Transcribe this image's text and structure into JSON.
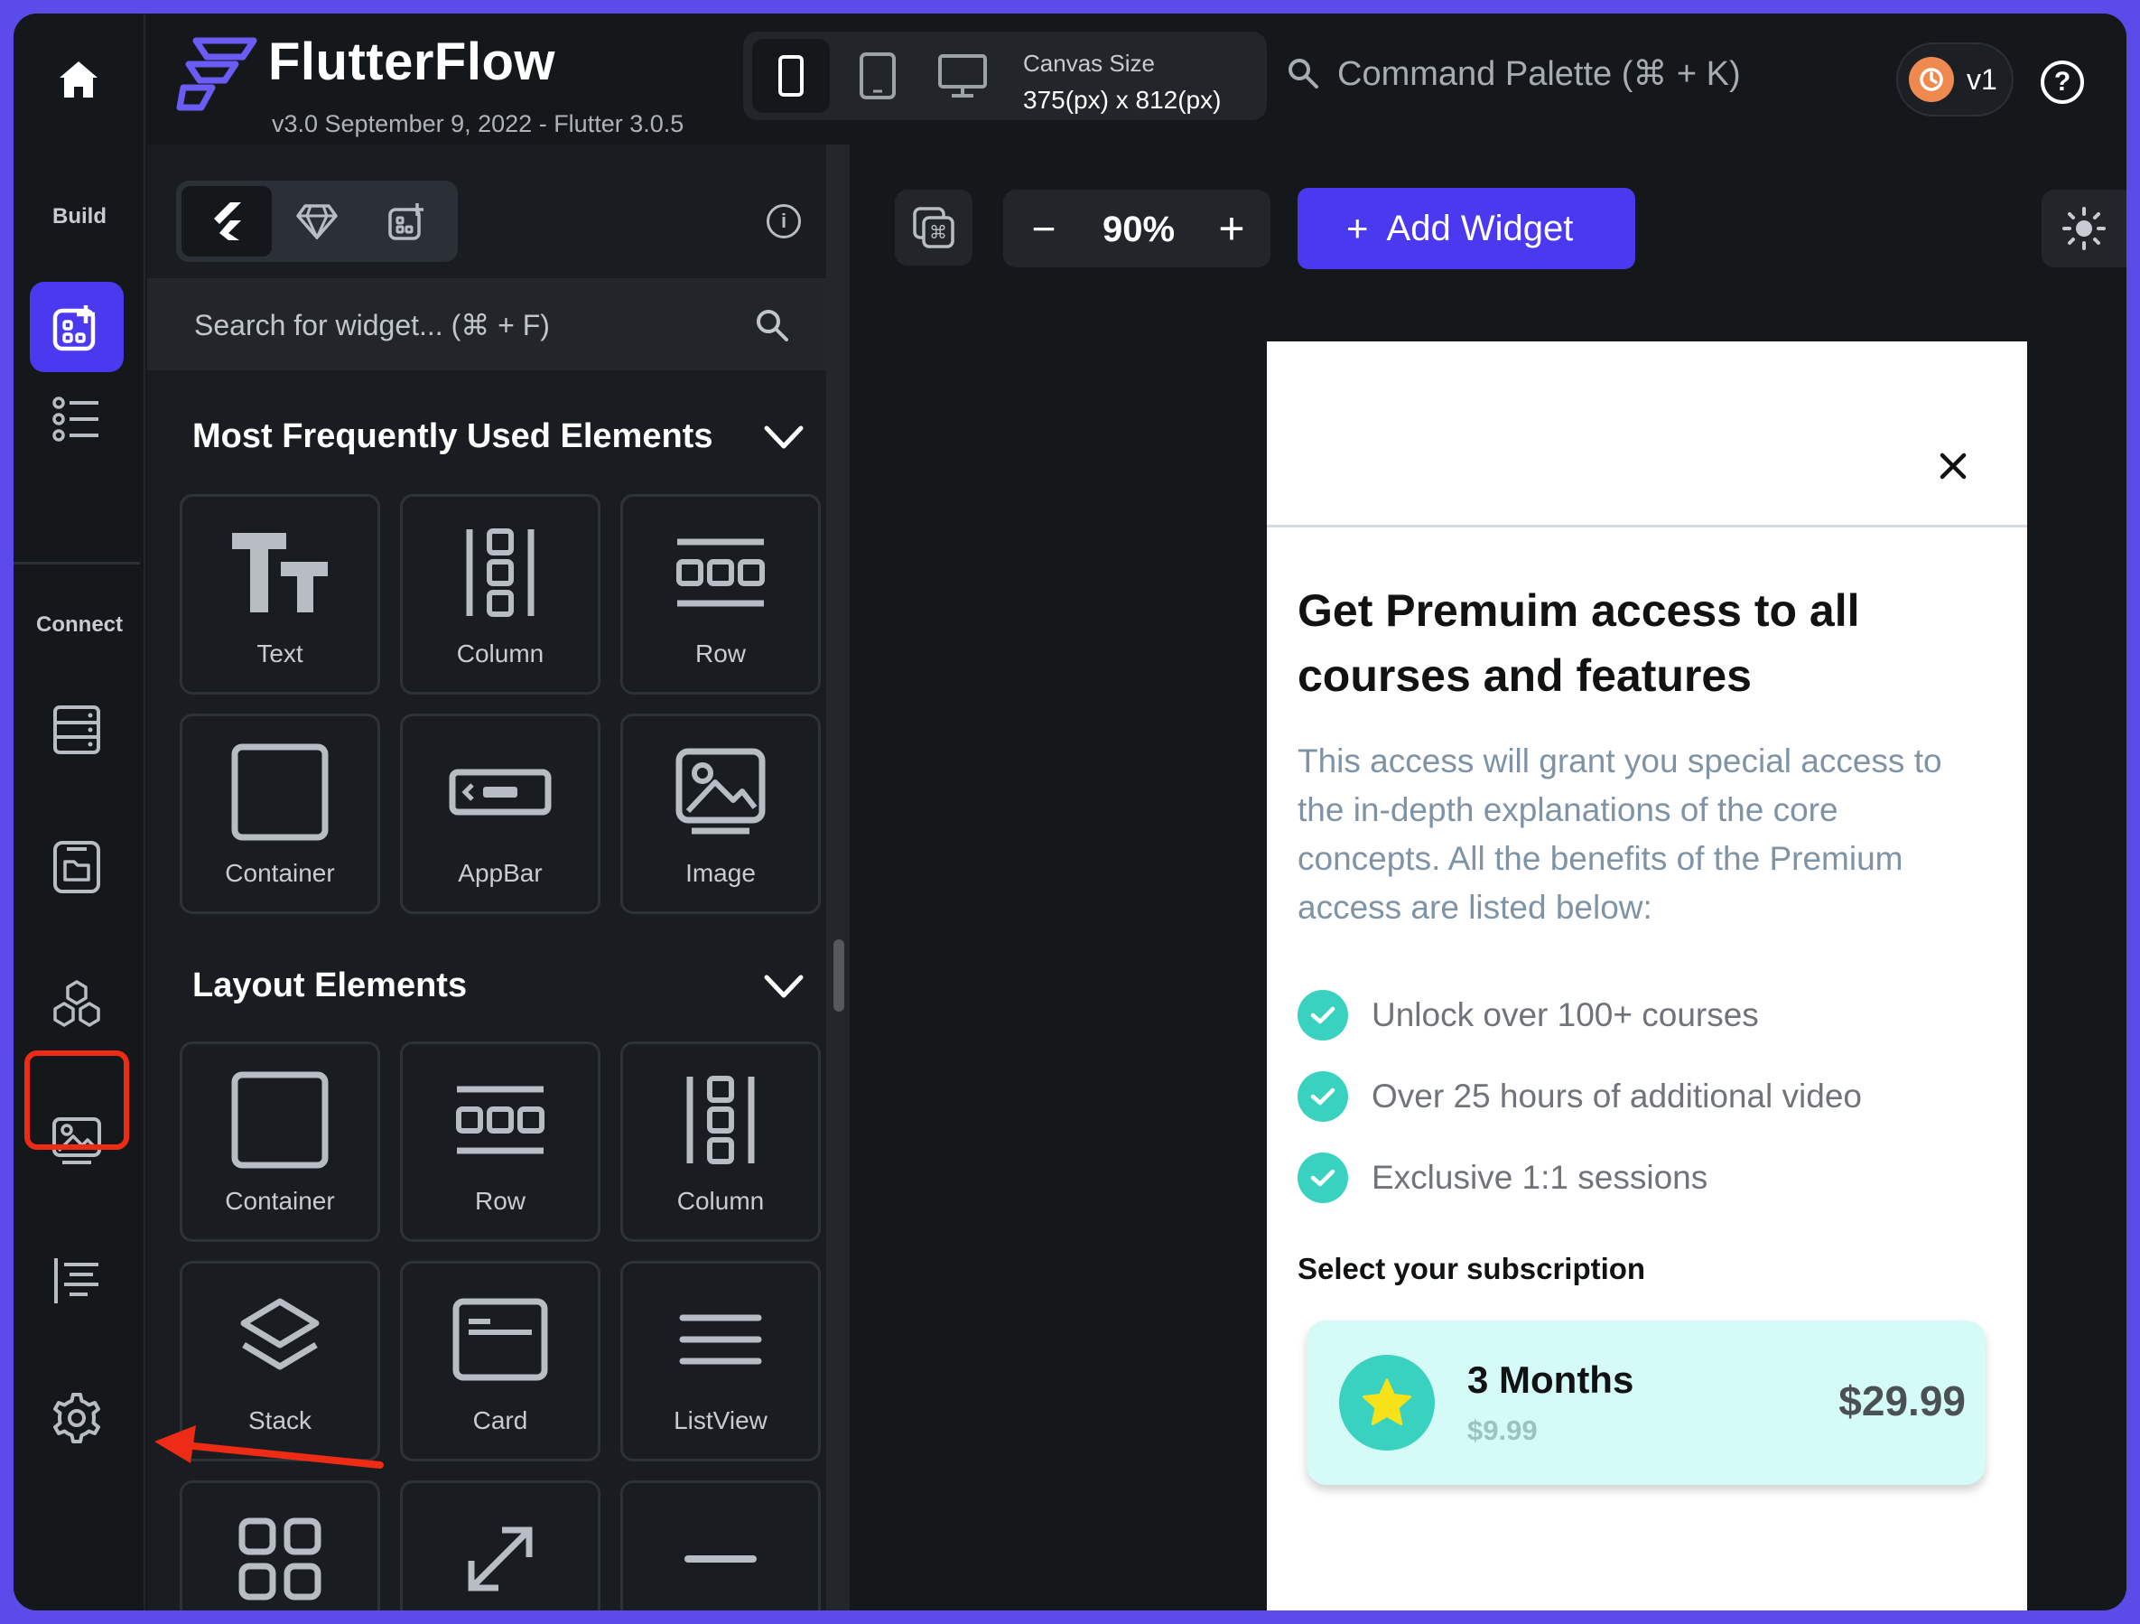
{
  "app": {
    "name": "FlutterFlow",
    "version": "v3.0 September 9, 2022 - Flutter 3.0.5"
  },
  "topbar": {
    "canvas_size_label": "Canvas Size",
    "canvas_size_value": "375(px) x 812(px)",
    "command_palette": "Command Palette (⌘ + K)",
    "version_label": "v1",
    "help_label": "?",
    "devices": [
      "phone-icon",
      "tablet-icon",
      "desktop-icon"
    ]
  },
  "left_nav": {
    "build_label": "Build",
    "connect_label": "Connect",
    "items": [
      "home-icon",
      "widgets-icon",
      "widget-tree-icon",
      "database-icon",
      "storage-icon",
      "integrations-icon",
      "media-icon",
      "api-icon",
      "settings-icon"
    ]
  },
  "widget_panel": {
    "tabs": [
      "flutter-icon",
      "gem-icon",
      "add-component-icon"
    ],
    "info_label": "i",
    "search_placeholder": "Search for widget... (⌘ + F)",
    "sections": [
      {
        "title": "Most Frequently Used Elements",
        "tiles": [
          {
            "label": "Text",
            "icon": "text-icon"
          },
          {
            "label": "Column",
            "icon": "column-icon"
          },
          {
            "label": "Row",
            "icon": "row-icon"
          },
          {
            "label": "Container",
            "icon": "container-icon"
          },
          {
            "label": "AppBar",
            "icon": "appbar-icon"
          },
          {
            "label": "Image",
            "icon": "image-icon"
          }
        ]
      },
      {
        "title": "Layout Elements",
        "tiles": [
          {
            "label": "Container",
            "icon": "container-icon"
          },
          {
            "label": "Row",
            "icon": "row-icon"
          },
          {
            "label": "Column",
            "icon": "column-icon"
          },
          {
            "label": "Stack",
            "icon": "stack-icon"
          },
          {
            "label": "Card",
            "icon": "card-icon"
          },
          {
            "label": "ListView",
            "icon": "listview-icon"
          },
          {
            "label": "",
            "icon": "grid-icon"
          },
          {
            "label": "",
            "icon": "expand-icon"
          },
          {
            "label": "",
            "icon": "divider-icon"
          }
        ]
      }
    ]
  },
  "canvas": {
    "zoom": "90%",
    "zoom_minus": "−",
    "zoom_plus": "+",
    "add_widget_plus": "+",
    "add_widget_label": "Add Widget"
  },
  "phone": {
    "title": "Get Premuim access to all courses and features",
    "description": "This access will grant you special access to the in-depth explanations of the core concepts. All the benefits of the Premium access are listed below:",
    "benefits": [
      "Unlock over 100+ courses",
      "Over 25 hours of additional video",
      "Exclusive 1:1 sessions"
    ],
    "select_label": "Select your subscription",
    "subscription": {
      "title": "3 Months",
      "old_price": "$9.99",
      "price": "$29.99"
    }
  },
  "colors": {
    "frame": "#5b4be8",
    "primary": "#4b39ef",
    "accent_teal": "#39d2c0",
    "card_bg": "#d4fbf5",
    "annotation_red": "#ee2b14",
    "star_yellow": "#f7e21a"
  }
}
